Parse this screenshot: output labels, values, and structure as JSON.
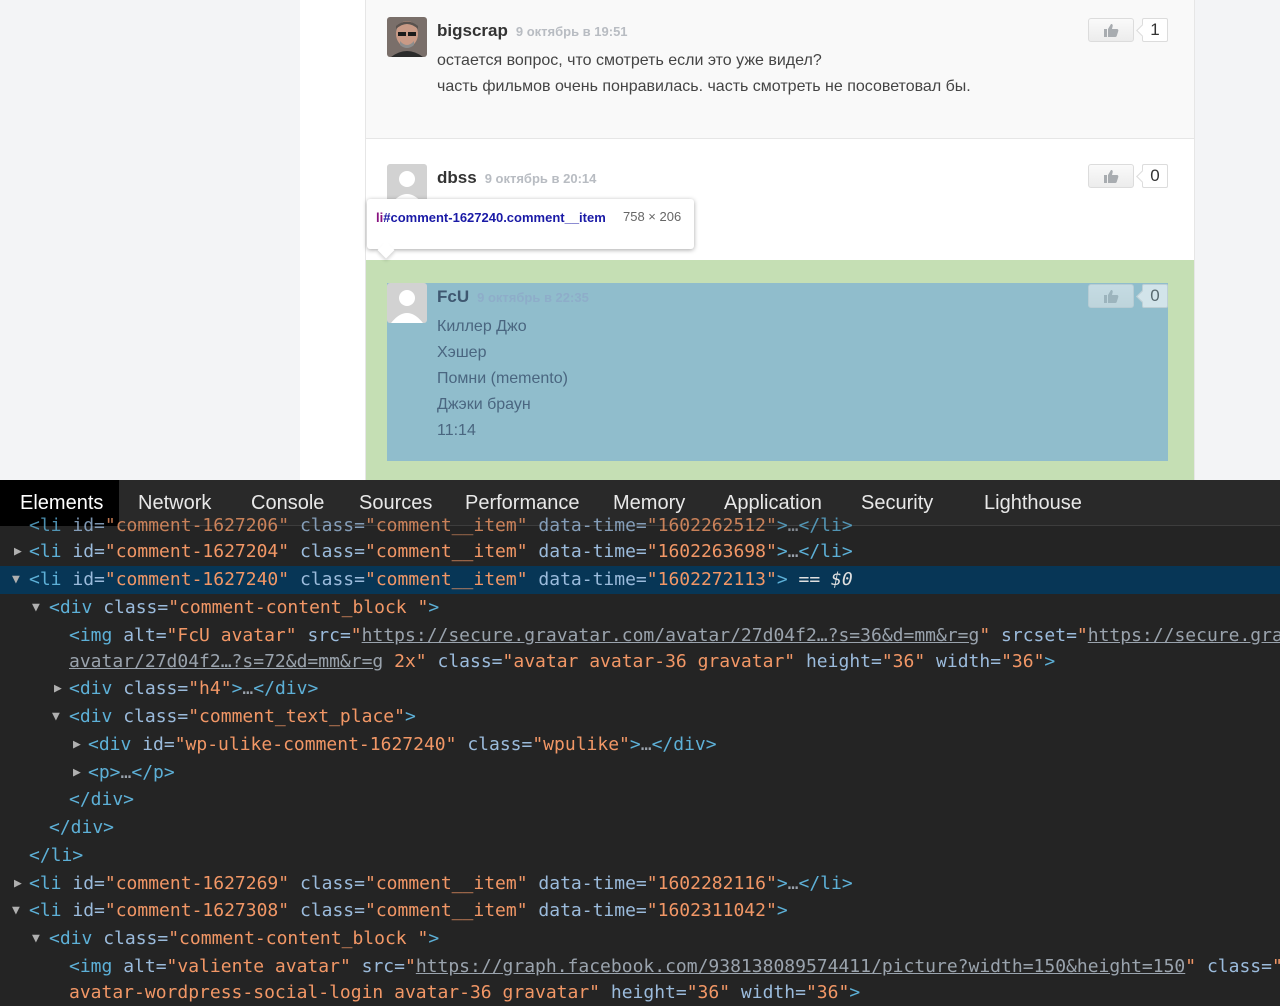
{
  "comments": [
    {
      "author": "bigscrap",
      "date": "9 октябрь в 19:51",
      "lines": [
        "остается вопрос, что смотреть если это уже видел?",
        "часть фильмов очень понравилась. часть смотреть не посоветовал бы."
      ],
      "likes": "1"
    },
    {
      "author": "dbss",
      "date": "9 октябрь в 20:14",
      "likes": "0"
    },
    {
      "author": "FcU",
      "date": "9 октябрь в 22:35",
      "lines": [
        "Киллер Джо",
        "Хэшер",
        "Помни (memento)",
        "Джэки браун",
        "11:14"
      ],
      "likes": "0"
    }
  ],
  "tooltip": {
    "tag": "li",
    "selector": "#comment-1627240.comment__item",
    "size": "758 × 206"
  },
  "devtools": {
    "tabs": [
      "Elements",
      "Network",
      "Console",
      "Sources",
      "Performance",
      "Memory",
      "Application",
      "Security",
      "Lighthouse"
    ],
    "active_tab": "Elements",
    "lines": [
      "<li id=\"comment-1627206\" class=\"comment__item\" data-time=\"1602262512\">…</li>",
      "<li id=\"comment-1627204\" class=\"comment__item\" data-time=\"1602263698\">…</li>",
      "<li id=\"comment-1627240\" class=\"comment__item\" data-time=\"1602272113\"> == $0",
      "<div class=\"comment-content_block \">",
      "<img alt=\"FcU avatar\" src=\"https://secure.gravatar.com/avatar/27d04f2…?s=36&d=mm&r=g\" srcset=\"https://secure.gravatar.com/",
      "avatar/27d04f2…?s=72&d=mm&r=g 2x\" class=\"avatar avatar-36 gravatar\" height=\"36\" width=\"36\">",
      "<div class=\"h4\">…</div>",
      "<div class=\"comment_text_place\">",
      "<div id=\"wp-ulike-comment-1627240\" class=\"wpulike\">…</div>",
      "<p>…</p>",
      "</div>",
      "</div>",
      "</li>",
      "<li id=\"comment-1627269\" class=\"comment__item\" data-time=\"1602282116\">…</li>",
      "<li id=\"comment-1627308\" class=\"comment__item\" data-time=\"1602311042\">",
      "<div class=\"comment-content_block \">",
      "<img alt=\"valiente avatar\" src=\"https://graph.facebook.com/938138089574411/picture?width=150&height=150\" class=\"avatar",
      "avatar-wordpress-social-login avatar-36 gravatar\" height=\"36\" width=\"36\">"
    ]
  }
}
